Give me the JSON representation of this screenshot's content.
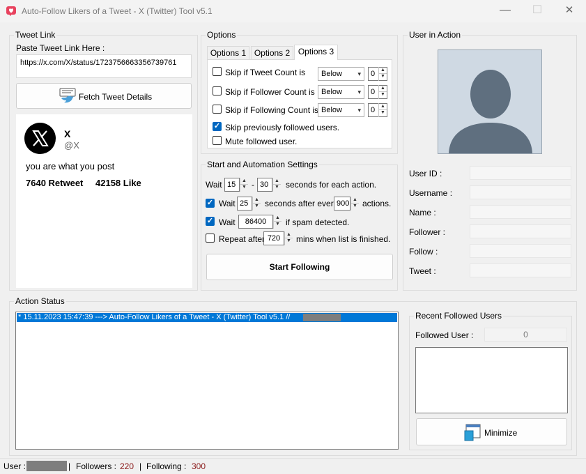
{
  "window": {
    "title": "Auto-Follow Likers of a Tweet - X (Twitter) Tool v5.1",
    "min_glyph": "—",
    "max_glyph": "☐",
    "close_glyph": "✕"
  },
  "tweet_link": {
    "group_title": "Tweet Link",
    "paste_label": "Paste Tweet Link Here :",
    "url_value": "https://x.com/X/status/1723756663356739761",
    "fetch_button": "Fetch Tweet Details",
    "card": {
      "name": "X",
      "handle": "@X",
      "text": "you are what you post",
      "retweets": "7640 Retweet",
      "likes": "42158 Like"
    }
  },
  "options": {
    "group_title": "Options",
    "tabs": [
      "Options 1",
      "Options 2",
      "Options 3"
    ],
    "active_tab": "Options 3",
    "rows": [
      {
        "label": "Skip if Tweet Count is",
        "checked": false,
        "combo": "Below",
        "value": "0"
      },
      {
        "label": "Skip if Follower Count is",
        "checked": false,
        "combo": "Below",
        "value": "0"
      },
      {
        "label": "Skip if Following Count is",
        "checked": false,
        "combo": "Below",
        "value": "0"
      }
    ],
    "skip_prev_label": "Skip previously followed users.",
    "skip_prev_checked": true,
    "mute_label": "Mute followed user.",
    "mute_checked": false
  },
  "automation": {
    "group_title": "Start and Automation Settings",
    "wait_label": "Wait",
    "wait_min": "15",
    "dash": "-",
    "wait_max": "30",
    "seconds_each": "seconds for each action.",
    "wait2_label": "Wait",
    "wait2_value": "25",
    "seconds_after": "seconds after every",
    "every_value": "900",
    "actions_label": "actions.",
    "wait3_label": "Wait",
    "spam_value": "86400",
    "spam_label": "if spam detected.",
    "repeat_label": "Repeat after",
    "repeat_value": "720",
    "mins_label": "mins when list is finished.",
    "start_button": "Start Following",
    "check_mark": "✓"
  },
  "user_in_action": {
    "group_title": "User in Action",
    "fields": [
      "User ID :",
      "Username :",
      "Name :",
      "Follower :",
      "Follow :",
      "Tweet :"
    ]
  },
  "action_status": {
    "group_title": "Action Status",
    "log_line": "* 15.11.2023 15:47:39 ---> Auto-Follow Likers of a Tweet - X (Twitter) Tool v5.1 //"
  },
  "recent": {
    "group_title": "Recent Followed Users",
    "followed_label": "Followed User :",
    "followed_count": "0",
    "minimize_button": "Minimize"
  },
  "status_bar": {
    "user_label": "User :",
    "sep1": "|",
    "followers_label": "Followers :",
    "followers_value": "220",
    "sep2": "|",
    "following_label": "Following :",
    "following_value": "300"
  },
  "colors": {
    "accent": "#0067c0",
    "selection": "#0078d7",
    "status_value": "#8b1a1a",
    "avatar_bg": "#cfd9e3",
    "avatar_fg": "#5f6f7f"
  }
}
